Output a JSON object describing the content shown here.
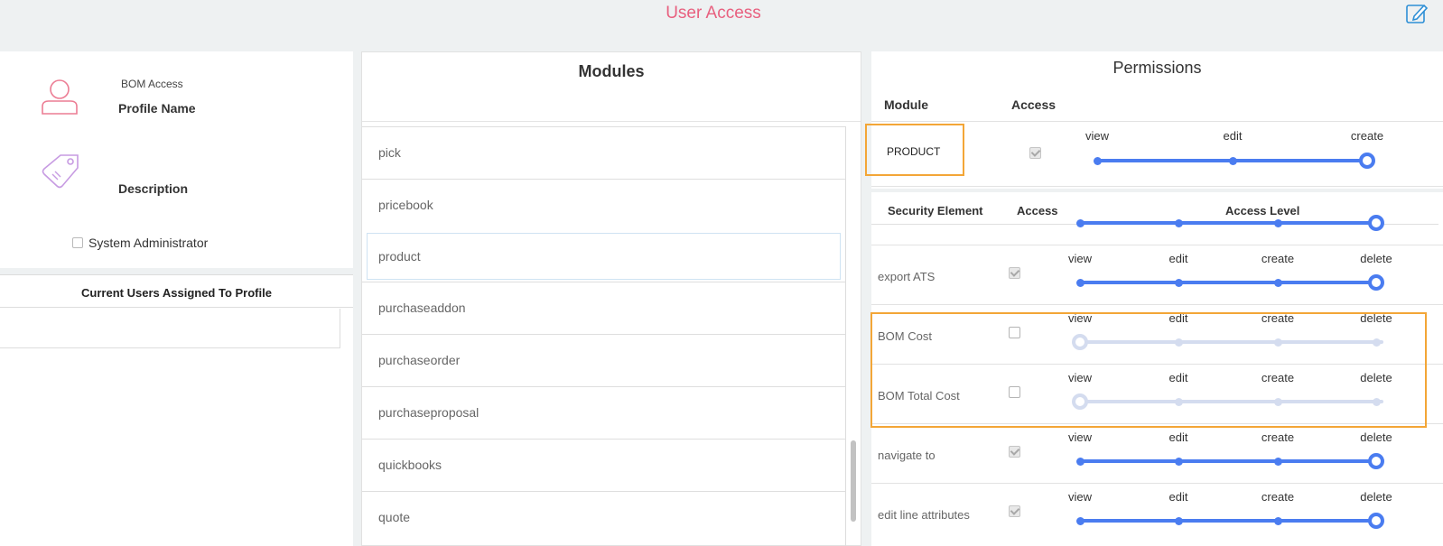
{
  "header": {
    "title": "User Access",
    "edit_icon": "edit-icon"
  },
  "profile": {
    "name_value": "BOM Access",
    "name_label": "Profile Name",
    "description_label": "Description",
    "sysadmin_label": "System Administrator",
    "sysadmin_checked": false,
    "icons": [
      "user-icon",
      "tag-icon"
    ]
  },
  "users": {
    "title": "Current Users Assigned To Profile"
  },
  "modules": {
    "title": "Modules",
    "items": [
      "pick",
      "pricebook",
      "product",
      "purchaseaddon",
      "purchaseorder",
      "purchaseproposal",
      "quickbooks",
      "quote"
    ],
    "selected": "product"
  },
  "permissions": {
    "title": "Permissions",
    "col_module": "Module",
    "col_access": "Access",
    "module_name": "PRODUCT",
    "module_access_checked": true,
    "levels": [
      "view",
      "edit",
      "create"
    ],
    "selected_level": "create"
  },
  "security": {
    "col_element": "Security Element",
    "col_access": "Access",
    "col_level": "Access Level",
    "levels": [
      "view",
      "edit",
      "create",
      "delete"
    ],
    "rows": [
      {
        "name": "export ATS",
        "access": true,
        "level": "delete"
      },
      {
        "name": "BOM Cost",
        "access": false,
        "level": "view"
      },
      {
        "name": "BOM Total Cost",
        "access": false,
        "level": "view"
      },
      {
        "name": "navigate to",
        "access": true,
        "level": "delete"
      },
      {
        "name": "edit line attributes",
        "access": true,
        "level": "delete"
      }
    ]
  },
  "colors": {
    "accent": "#4a7cf0",
    "disabled_track": "#d4dcef",
    "title": "#e8607f",
    "highlight": "#f3a637"
  }
}
